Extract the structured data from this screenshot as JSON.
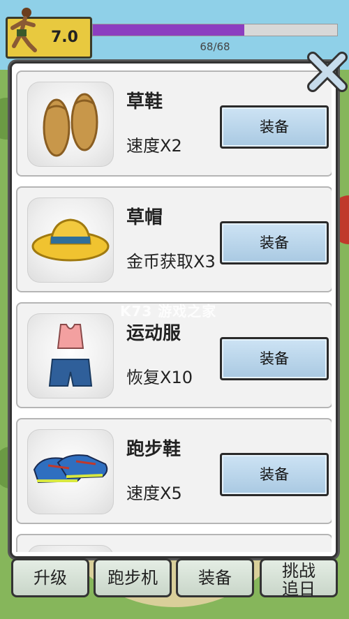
{
  "hud": {
    "level": "7.0",
    "hp_text": "68/68",
    "progress": 0.62
  },
  "items": [
    {
      "name": "草鞋",
      "effect": "速度X2",
      "button": "装备",
      "icon": "straw-sandals-icon"
    },
    {
      "name": "草帽",
      "effect": "金币获取X3",
      "button": "装备",
      "icon": "straw-hat-icon"
    },
    {
      "name": "运动服",
      "effect": "恢复X10",
      "button": "装备",
      "icon": "sportswear-icon"
    },
    {
      "name": "跑步鞋",
      "effect": "速度X5",
      "button": "装备",
      "icon": "running-shoes-icon"
    },
    {
      "name": "",
      "effect": "",
      "button": "",
      "icon": "partial-item-icon"
    }
  ],
  "nav": {
    "upgrade": "升级",
    "treadmill": "跑步机",
    "equipment": "装备",
    "challenge_line1": "挑战",
    "challenge_line2": "追日"
  },
  "watermark": "K73 游戏之家",
  "colors": {
    "progress": "#8c3ec0",
    "equip_button": "#bcd7ec",
    "level_badge": "#e8c93f"
  }
}
